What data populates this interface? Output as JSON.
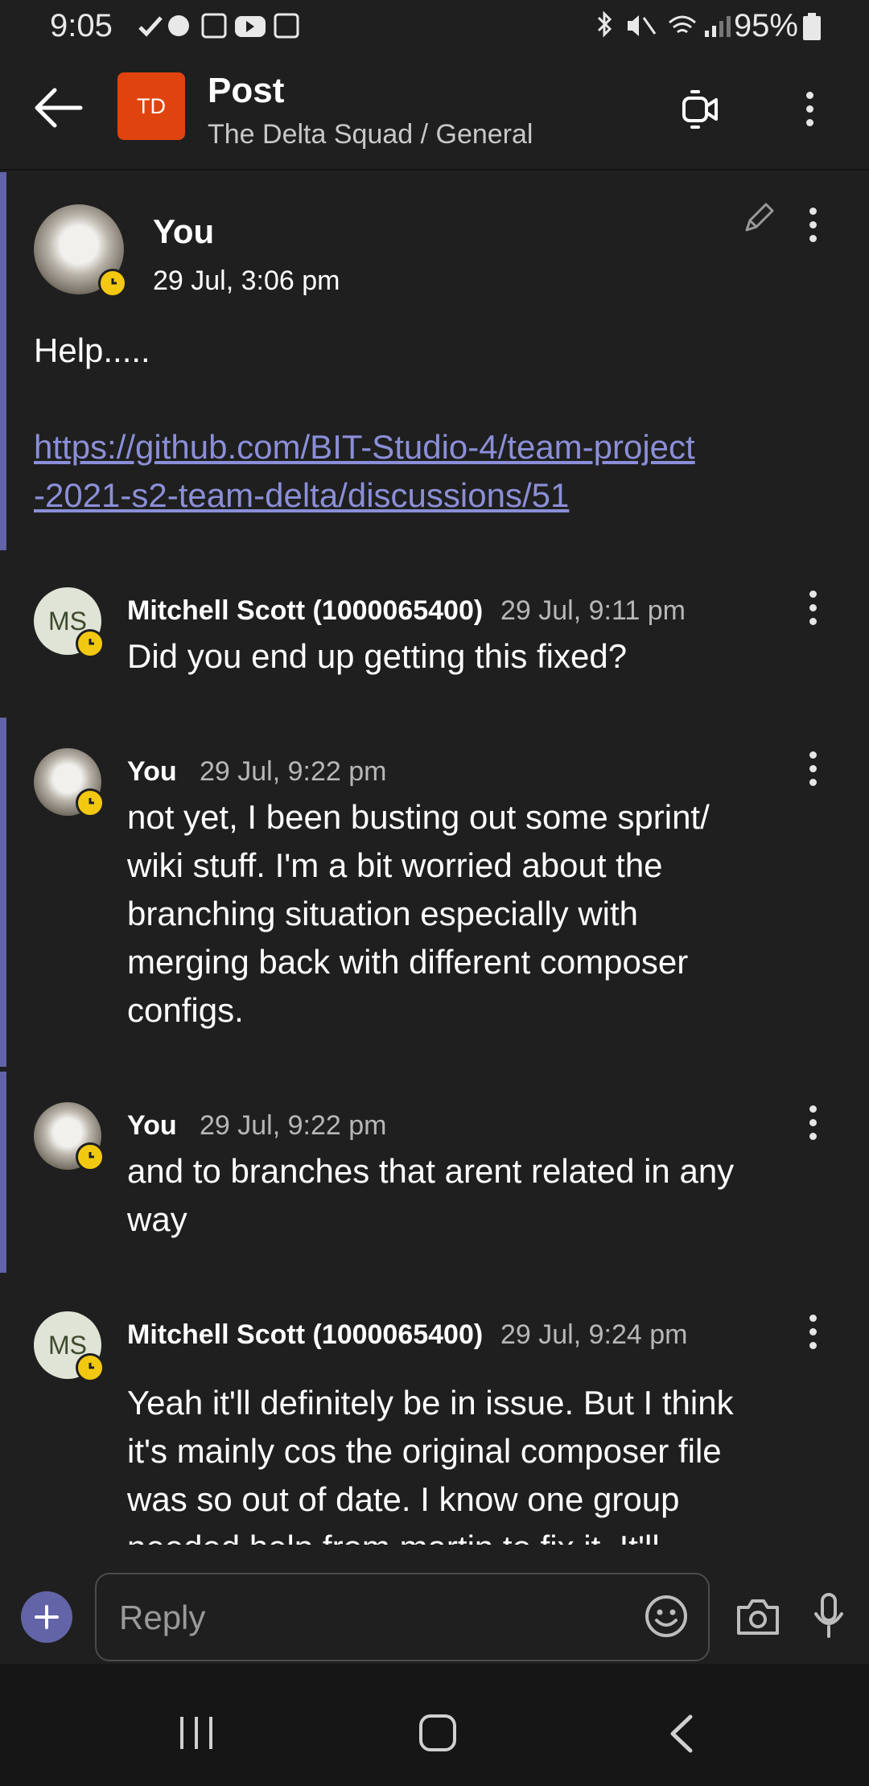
{
  "status_bar": {
    "time": "9:05",
    "battery": "95%"
  },
  "header": {
    "team_initials": "TD",
    "title": "Post",
    "subtitle": "The Delta Squad / General"
  },
  "thread": {
    "root": {
      "author": "You",
      "timestamp": "29 Jul, 3:06 pm",
      "text": "Help.....",
      "link_line1": "https://github.com/BIT-Studio-4/team-project",
      "link_line2": "-2021-s2-team-delta/discussions/51"
    },
    "replies": [
      {
        "avatar": "",
        "author": "Mitchell Scott (1000065400)",
        "timestamp": "29 Jul, 9:11 pm",
        "lines": [
          "Did you end up getting this fixed?"
        ]
      },
      {
        "author": "You",
        "timestamp": "29 Jul, 9:22 pm",
        "lines": [
          "not yet, I been busting out some sprint/",
          "wiki stuff. I'm a bit worried about the",
          "branching situation especially with",
          "merging back with different composer",
          "configs."
        ]
      },
      {
        "author": "You",
        "timestamp": "29 Jul, 9:22 pm",
        "lines": [
          "and to branches that arent related in any",
          "way"
        ]
      },
      {
        "avatar": "MS",
        "author": "Mitchell Scott (1000065400)",
        "timestamp": "29 Jul, 9:24 pm",
        "lines": [
          "Yeah it'll definitely be in issue. But I think",
          "it's mainly cos the original composer file",
          "was so out of date. I know one group",
          "needed help from martin to fix it. It'll"
        ]
      }
    ]
  },
  "composer": {
    "placeholder": "Reply"
  },
  "colors": {
    "accent": "#6264a7",
    "team_tile": "#e0440e",
    "presence_away": "#f2c811",
    "link": "#8b8fd8"
  },
  "icons": [
    "back-arrow-icon",
    "video-call-icon",
    "more-vertical-icon",
    "edit-pencil-icon",
    "plus-icon",
    "emoji-icon",
    "camera-icon",
    "microphone-icon",
    "recents-icon",
    "home-icon",
    "nav-back-icon"
  ]
}
